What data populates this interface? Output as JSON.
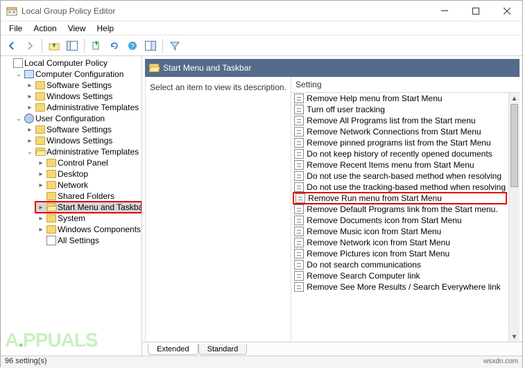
{
  "window": {
    "title": "Local Group Policy Editor"
  },
  "menu": {
    "file": "File",
    "action": "Action",
    "view": "View",
    "help": "Help"
  },
  "tree": {
    "root": "Local Computer Policy",
    "comp_config": "Computer Configuration",
    "cc_soft": "Software Settings",
    "cc_win": "Windows Settings",
    "cc_admin": "Administrative Templates",
    "user_config": "User Configuration",
    "uc_soft": "Software Settings",
    "uc_win": "Windows Settings",
    "uc_admin": "Administrative Templates",
    "at_control": "Control Panel",
    "at_desktop": "Desktop",
    "at_network": "Network",
    "at_shared": "Shared Folders",
    "at_start": "Start Menu and Taskbar",
    "at_system": "System",
    "at_wincomp": "Windows Components",
    "at_all": "All Settings"
  },
  "right": {
    "header": "Start Menu and Taskbar",
    "desc_prompt": "Select an item to view its description.",
    "column_setting": "Setting",
    "tabs": {
      "extended": "Extended",
      "standard": "Standard"
    }
  },
  "settings": [
    "Remove Help menu from Start Menu",
    "Turn off user tracking",
    "Remove All Programs list from the Start menu",
    "Remove Network Connections from Start Menu",
    "Remove pinned programs list from the Start Menu",
    "Do not keep history of recently opened documents",
    "Remove Recent Items menu from Start Menu",
    "Do not use the search-based method when resolving",
    "Do not use the tracking-based method when resolving",
    "Remove Run menu from Start Menu",
    "Remove Default Programs link from the Start menu.",
    "Remove Documents icon from Start Menu",
    "Remove Music icon from Start Menu",
    "Remove Network icon from Start Menu",
    "Remove Pictures icon from Start Menu",
    "Do not search communications",
    "Remove Search Computer link",
    "Remove See More Results / Search Everywhere link"
  ],
  "status": {
    "count": "96 setting(s)"
  },
  "watermark": {
    "text_a": "A",
    "text_rest": "PPUALS",
    "dot": "."
  },
  "sig": "wsxdn.com"
}
